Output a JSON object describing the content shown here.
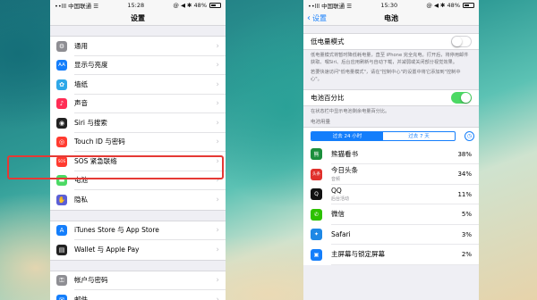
{
  "left": {
    "status": {
      "carrier": "••lll 中国联通 ☰",
      "time": "15:28",
      "right": "@ ◀ ✱ 48%"
    },
    "nav_title": "设置",
    "groups": [
      [
        {
          "label": "通用",
          "icon": "gear-icon",
          "color": "#8e8e93",
          "glyph": "⚙"
        },
        {
          "label": "显示与亮度",
          "icon": "display-icon",
          "color": "#147efb",
          "glyph": "AA"
        },
        {
          "label": "墙纸",
          "icon": "wallpaper-icon",
          "color": "#2ea8e8",
          "glyph": "✿"
        },
        {
          "label": "声音",
          "icon": "sound-icon",
          "color": "#ff2d55",
          "glyph": "♪"
        },
        {
          "label": "Siri 与搜索",
          "icon": "siri-icon",
          "color": "#222222",
          "glyph": "◉"
        },
        {
          "label": "Touch ID 与密码",
          "icon": "fingerprint-icon",
          "color": "#ff3b30",
          "glyph": "◎"
        },
        {
          "label": "SOS 紧急联络",
          "icon": "sos-icon",
          "color": "#ff3b30",
          "glyph": "SOS"
        },
        {
          "label": "电池",
          "icon": "battery-icon",
          "color": "#4cd964",
          "glyph": "▬"
        },
        {
          "label": "隐私",
          "icon": "privacy-icon",
          "color": "#5b5fd6",
          "glyph": "✋"
        }
      ],
      [
        {
          "label": "iTunes Store 与 App Store",
          "icon": "app-store-icon",
          "color": "#147efb",
          "glyph": "A"
        },
        {
          "label": "Wallet 与 Apple Pay",
          "icon": "wallet-icon",
          "color": "#222222",
          "glyph": "▤"
        }
      ],
      [
        {
          "label": "帐户与密码",
          "icon": "key-icon",
          "color": "#8e8e93",
          "glyph": "⚿"
        },
        {
          "label": "邮件",
          "icon": "mail-icon",
          "color": "#147efb",
          "glyph": "✉"
        }
      ]
    ]
  },
  "right": {
    "status": {
      "carrier": "••lll 中国联通 ☰",
      "time": "15:30",
      "right": "@ ◀ ✱ 48%"
    },
    "back_label": "设置",
    "nav_title": "电池",
    "low_power_label": "低电量模式",
    "low_power_on": false,
    "low_power_note": "低电量模式将暂时降低耗电量，直至 iPhone 完全充电。打开后，将停用邮件获取、嘿Siri、后台应用刷新与自动下载，并减弱或关闭部分视觉效果。",
    "low_power_note2": "若要快速访问\"低电量模式\"，请在\"控制中心\"的设置中将它添加到\"控制中心\"。",
    "percent_label": "电池百分比",
    "percent_on": true,
    "percent_note": "在状态栏中显示电池剩余电量百分比。",
    "usage_header": "电池用量",
    "tabs": [
      "过去 24 小时",
      "过去 7 天"
    ],
    "active_tab": 0,
    "apps": [
      {
        "name": "熊猫看书",
        "sub": "",
        "pct": "38%",
        "color": "#1b8e3c",
        "icon": "panda-icon",
        "glyph": "熊"
      },
      {
        "name": "今日头条",
        "sub": "音频",
        "pct": "34%",
        "color": "#e0312c",
        "icon": "toutiao-icon",
        "glyph": "头条"
      },
      {
        "name": "QQ",
        "sub": "后台活动",
        "pct": "11%",
        "color": "#111111",
        "icon": "qq-icon",
        "glyph": "Q"
      },
      {
        "name": "微信",
        "sub": "",
        "pct": "5%",
        "color": "#2dc100",
        "icon": "wechat-icon",
        "glyph": "✆"
      },
      {
        "name": "Safari",
        "sub": "",
        "pct": "3%",
        "color": "#1e88e5",
        "icon": "safari-icon",
        "glyph": "✦"
      },
      {
        "name": "主屏幕与锁定屏幕",
        "sub": "",
        "pct": "2%",
        "color": "#147efb",
        "icon": "home-screen-icon",
        "glyph": "▣"
      }
    ]
  }
}
